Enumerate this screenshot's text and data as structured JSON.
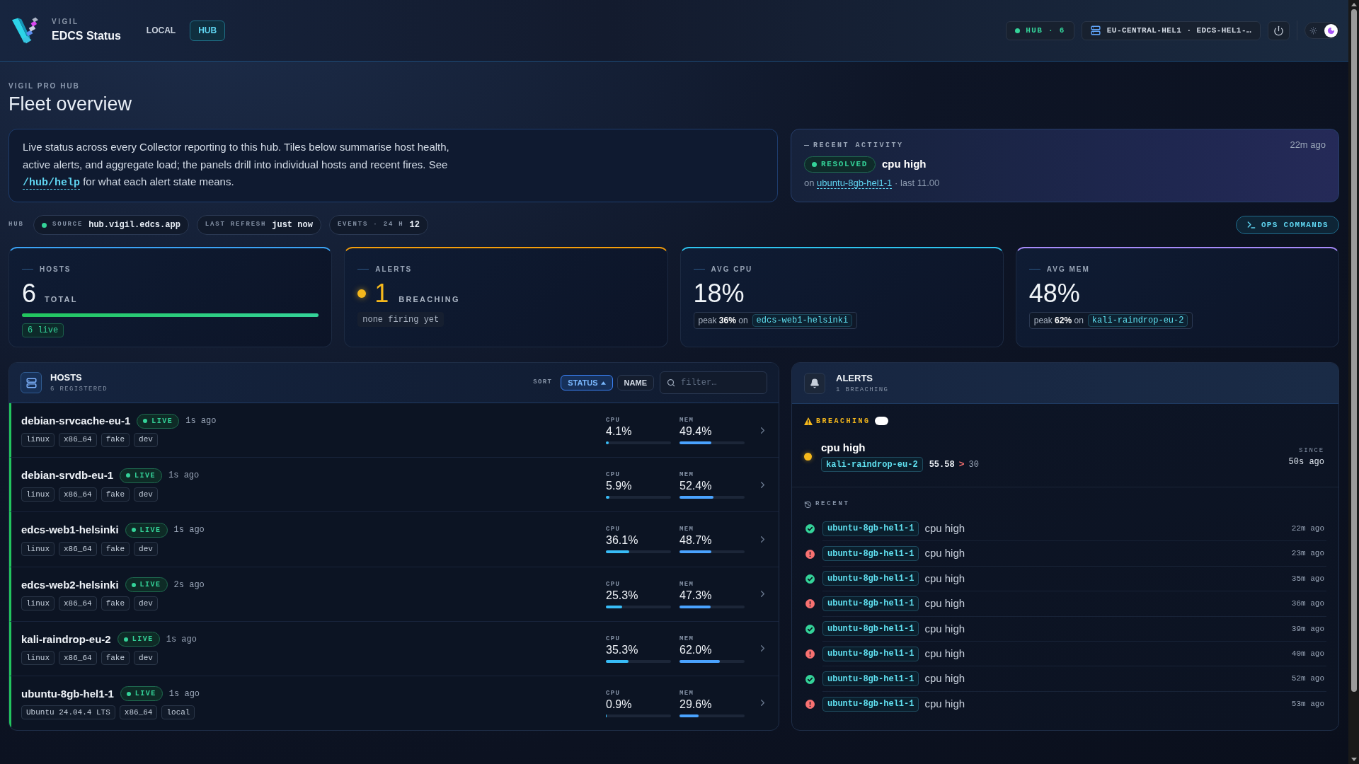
{
  "header": {
    "brand": {
      "kicker": "VIGIL",
      "title": "EDCS Status"
    },
    "tabs": [
      {
        "label": "LOCAL",
        "selected": false
      },
      {
        "label": "HUB",
        "selected": true
      }
    ],
    "hub_status": {
      "label": "HUB · 6",
      "online": true
    },
    "node": "EU-CENTRAL-HEL1 · EDCS-HEL1-…",
    "theme": {
      "dark": true
    }
  },
  "page": {
    "kicker": "VIGIL PRO HUB",
    "title": "Fleet overview"
  },
  "intro": {
    "text": "Live status across every Collector reporting to this hub. Tiles below summarise host health, active alerts, and aggregate load; the panels drill into individual hosts and recent fires. See",
    "link": "/hub/help",
    "text_after": "for what each alert state means."
  },
  "recent_activity": {
    "label": "RECENT ACTIVITY",
    "time": "22m ago",
    "status": "RESOLVED",
    "resolved": true,
    "title": "cpu high",
    "on": "on",
    "host": "ubuntu-8gb-hel1-1",
    "detail": "· last 11.00"
  },
  "hub_strip": {
    "label": "HUB",
    "chips": [
      {
        "label": "SOURCE",
        "value": "hub.vigil.edcs.app",
        "dot": true
      },
      {
        "label": "LAST REFRESH",
        "value": "just now",
        "dot": false
      },
      {
        "label": "EVENTS · 24 H",
        "value": "12",
        "dot": false
      }
    ],
    "ops_button": "OPS COMMANDS"
  },
  "tiles": [
    {
      "kind": "hosts",
      "label": "HOSTS",
      "value": "6",
      "unit": "TOTAL",
      "level": 1,
      "note": "6 live"
    },
    {
      "kind": "alerts",
      "label": "ALERTS",
      "value": "1",
      "unit": "BREACHING",
      "note": "none firing yet"
    },
    {
      "kind": "cpu",
      "label": "AVG CPU",
      "value": "18%",
      "peak": "peak **36%** on",
      "peak_host": "edcs-web1-helsinki"
    },
    {
      "kind": "mem",
      "label": "AVG MEM",
      "value": "48%",
      "peak": "peak **62%** on",
      "peak_host": "kali-raindrop-eu-2"
    }
  ],
  "hosts_panel": {
    "title": "HOSTS",
    "subtitle": "6 REGISTERED",
    "sort_label": "SORT",
    "sort_options": [
      {
        "label": "STATUS",
        "selected": true
      },
      {
        "label": "NAME",
        "selected": false
      }
    ],
    "filter_placeholder": "filter…",
    "hosts": [
      {
        "name": "debian-srvcache-eu-1",
        "status": "LIVE",
        "live": true,
        "age": "1s ago",
        "tags": [
          "linux",
          "x86_64",
          "fake",
          "dev"
        ],
        "cpu": {
          "label": "CPU",
          "reading": "4.1%",
          "level": 0.041
        },
        "mem": {
          "label": "MEM",
          "reading": "49.4%",
          "level": 0.494
        }
      },
      {
        "name": "debian-srvdb-eu-1",
        "status": "LIVE",
        "live": true,
        "age": "1s ago",
        "tags": [
          "linux",
          "x86_64",
          "fake",
          "dev"
        ],
        "cpu": {
          "label": "CPU",
          "reading": "5.9%",
          "level": 0.059
        },
        "mem": {
          "label": "MEM",
          "reading": "52.4%",
          "level": 0.524
        }
      },
      {
        "name": "edcs-web1-helsinki",
        "status": "LIVE",
        "live": true,
        "age": "1s ago",
        "tags": [
          "linux",
          "x86_64",
          "fake",
          "dev"
        ],
        "cpu": {
          "label": "CPU",
          "reading": "36.1%",
          "level": 0.361
        },
        "mem": {
          "label": "MEM",
          "reading": "48.7%",
          "level": 0.487
        }
      },
      {
        "name": "edcs-web2-helsinki",
        "status": "LIVE",
        "live": true,
        "age": "2s ago",
        "tags": [
          "linux",
          "x86_64",
          "fake",
          "dev"
        ],
        "cpu": {
          "label": "CPU",
          "reading": "25.3%",
          "level": 0.253
        },
        "mem": {
          "label": "MEM",
          "reading": "47.3%",
          "level": 0.473
        }
      },
      {
        "name": "kali-raindrop-eu-2",
        "status": "LIVE",
        "live": true,
        "age": "1s ago",
        "tags": [
          "linux",
          "x86_64",
          "fake",
          "dev"
        ],
        "cpu": {
          "label": "CPU",
          "reading": "35.3%",
          "level": 0.353
        },
        "mem": {
          "label": "MEM",
          "reading": "62.0%",
          "level": 0.62
        }
      },
      {
        "name": "ubuntu-8gb-hel1-1",
        "status": "LIVE",
        "live": true,
        "age": "1s ago",
        "tags": [
          "Ubuntu 24.04.4 LTS",
          "x86_64",
          "local"
        ],
        "cpu": {
          "label": "CPU",
          "reading": "0.9%",
          "level": 0.009
        },
        "mem": {
          "label": "MEM",
          "reading": "29.6%",
          "level": 0.296
        }
      }
    ]
  },
  "alerts_panel": {
    "title": "ALERTS",
    "subtitle": "1 BREACHING",
    "breaching_label": "BREACHING",
    "active": [
      {
        "title": "cpu high",
        "host": "kali-raindrop-eu-2",
        "value": "55.58",
        "operator": ">",
        "threshold": "30",
        "since_label": "SINCE",
        "since": "50s ago"
      }
    ],
    "recent_label": "RECENT",
    "recent": [
      {
        "kind": "resolved",
        "host": "ubuntu-8gb-hel1-1",
        "title": "cpu high",
        "time": "22m ago"
      },
      {
        "kind": "fired",
        "host": "ubuntu-8gb-hel1-1",
        "title": "cpu high",
        "time": "23m ago"
      },
      {
        "kind": "resolved",
        "host": "ubuntu-8gb-hel1-1",
        "title": "cpu high",
        "time": "35m ago"
      },
      {
        "kind": "fired",
        "host": "ubuntu-8gb-hel1-1",
        "title": "cpu high",
        "time": "36m ago"
      },
      {
        "kind": "resolved",
        "host": "ubuntu-8gb-hel1-1",
        "title": "cpu high",
        "time": "39m ago"
      },
      {
        "kind": "fired",
        "host": "ubuntu-8gb-hel1-1",
        "title": "cpu high",
        "time": "40m ago"
      },
      {
        "kind": "resolved",
        "host": "ubuntu-8gb-hel1-1",
        "title": "cpu high",
        "time": "52m ago"
      },
      {
        "kind": "fired",
        "host": "ubuntu-8gb-hel1-1",
        "title": "cpu high",
        "time": "53m ago"
      }
    ]
  }
}
